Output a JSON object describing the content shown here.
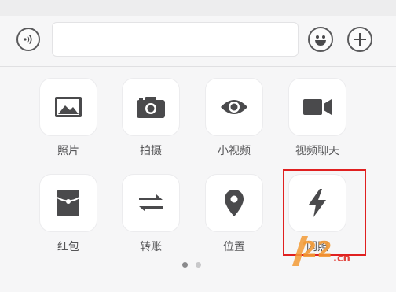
{
  "colors": {
    "icon": "#4a4a4c",
    "tile_bg": "#ffffff",
    "panel_bg": "#f6f6f7",
    "highlight": "#e02020",
    "watermark_orange": "#f29a35",
    "watermark_red": "#e0322a"
  },
  "input_bar": {
    "voice_icon": "voice-icon",
    "text_value": "",
    "emoji_icon": "emoji-icon",
    "plus_icon": "plus-icon"
  },
  "actions": [
    {
      "label": "照片",
      "icon": "photo-icon"
    },
    {
      "label": "拍摄",
      "icon": "camera-icon"
    },
    {
      "label": "小视频",
      "icon": "eye-icon"
    },
    {
      "label": "视频聊天",
      "icon": "video-camera-icon"
    },
    {
      "label": "红包",
      "icon": "red-packet-icon"
    },
    {
      "label": "转账",
      "icon": "transfer-icon"
    },
    {
      "label": "位置",
      "icon": "location-pin-icon"
    },
    {
      "label": "闪照",
      "icon": "lightning-icon"
    }
  ],
  "pager": {
    "pages": 2,
    "current": 1
  },
  "watermark": {
    "text": "22",
    "suffix": ".cn"
  }
}
